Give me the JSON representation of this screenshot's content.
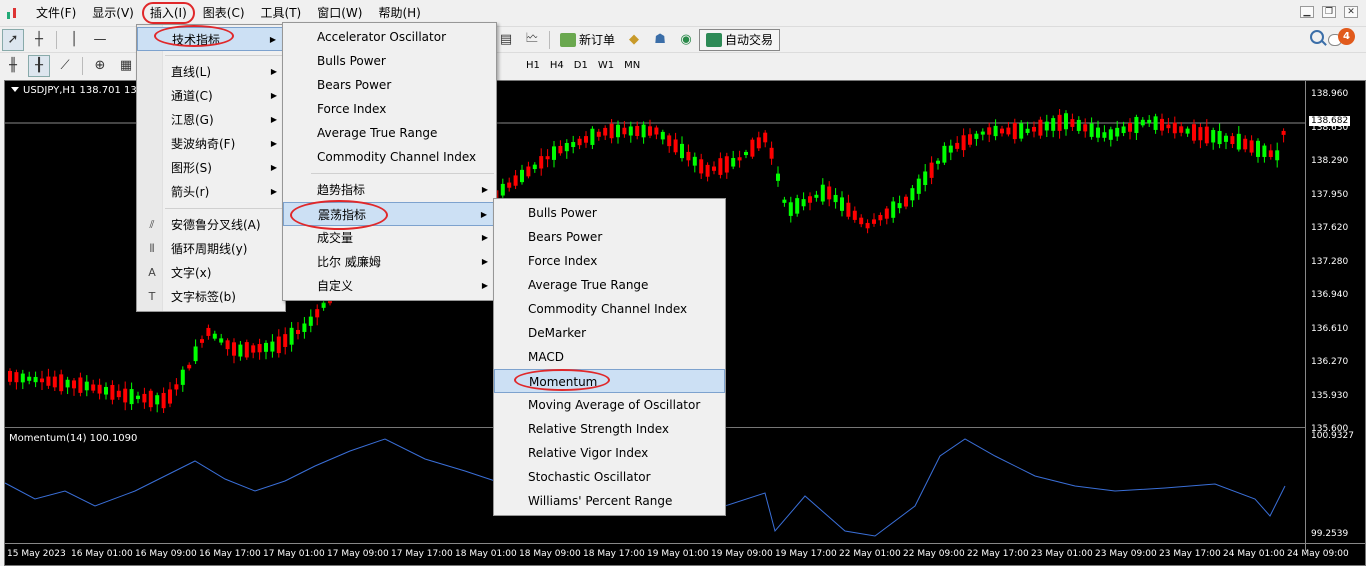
{
  "menubar": {
    "items": [
      "文件(F)",
      "显示(V)",
      "插入(I)",
      "图表(C)",
      "工具(T)",
      "窗口(W)",
      "帮助(H)"
    ],
    "active_index": 2
  },
  "toolbar1": {
    "new_order": "新订单",
    "auto_trading": "自动交易",
    "notification_count": "4"
  },
  "toolbar2": {
    "timeframes": [
      "H1",
      "H4",
      "D1",
      "W1",
      "MN"
    ]
  },
  "chart": {
    "title": "USDJPY,H1  138.701 138.7",
    "current_price": "138.682",
    "price_labels": [
      "138.960",
      "138.630",
      "138.290",
      "137.950",
      "137.620",
      "137.280",
      "136.940",
      "136.610",
      "136.270",
      "135.930",
      "135.600"
    ],
    "indicator_title": "Momentum(14) 100.1090",
    "indicator_labels": [
      "100.9327",
      "99.2539"
    ],
    "time_labels": [
      "15 May 2023",
      "16 May 01:00",
      "16 May 09:00",
      "16 May 17:00",
      "17 May 01:00",
      "17 May 09:00",
      "17 May 17:00",
      "18 May 01:00",
      "18 May 09:00",
      "18 May 17:00",
      "19 May 01:00",
      "19 May 09:00",
      "19 May 17:00",
      "22 May 01:00",
      "22 May 09:00",
      "22 May 17:00",
      "23 May 01:00",
      "23 May 09:00",
      "23 May 17:00",
      "24 May 01:00",
      "24 May 09:00"
    ],
    "colors": {
      "bull": "#00ff00",
      "bear": "#ff0000",
      "momentum": "#3a6fd8"
    }
  },
  "menu_insert": {
    "items": [
      {
        "label": "技术指标",
        "icon": "",
        "submenu": true,
        "highlight": true
      },
      {
        "sep": true
      },
      {
        "label": "直线(L)",
        "icon": "",
        "submenu": true
      },
      {
        "label": "通道(C)",
        "icon": "",
        "submenu": true
      },
      {
        "label": "江恩(G)",
        "icon": "",
        "submenu": true
      },
      {
        "label": "斐波纳奇(F)",
        "icon": "",
        "submenu": true
      },
      {
        "label": "图形(S)",
        "icon": "",
        "submenu": true
      },
      {
        "label": "箭头(r)",
        "icon": "",
        "submenu": true
      },
      {
        "sep": true
      },
      {
        "label": "安德鲁分叉线(A)",
        "icon": "pitchfork-icon",
        "submenu": false
      },
      {
        "label": "循环周期线(y)",
        "icon": "cycle-lines-icon",
        "submenu": false
      },
      {
        "label": "文字(x)",
        "icon": "text-icon",
        "submenu": false
      },
      {
        "label": "文字标签(b)",
        "icon": "text-label-icon",
        "submenu": false
      }
    ]
  },
  "menu_indicators": {
    "items": [
      {
        "label": "Accelerator Oscillator"
      },
      {
        "label": "Bulls Power"
      },
      {
        "label": "Bears Power"
      },
      {
        "label": "Force Index"
      },
      {
        "label": "Average True Range"
      },
      {
        "label": "Commodity Channel Index"
      },
      {
        "sep": true
      },
      {
        "label": "趋势指标",
        "submenu": true
      },
      {
        "label": "震荡指标",
        "submenu": true,
        "highlight": true
      },
      {
        "label": "成交量",
        "submenu": true
      },
      {
        "label": "比尔 威廉姆",
        "submenu": true
      },
      {
        "label": "自定义",
        "submenu": true
      }
    ]
  },
  "menu_oscillators": {
    "items": [
      {
        "label": "Bulls Power"
      },
      {
        "label": "Bears Power"
      },
      {
        "label": "Force Index"
      },
      {
        "label": "Average True Range"
      },
      {
        "label": "Commodity Channel Index"
      },
      {
        "label": "DeMarker"
      },
      {
        "label": "MACD"
      },
      {
        "label": "Momentum",
        "highlight": true
      },
      {
        "label": "Moving Average of Oscillator"
      },
      {
        "label": "Relative Strength Index"
      },
      {
        "label": "Relative Vigor Index"
      },
      {
        "label": "Stochastic Oscillator"
      },
      {
        "label": "Williams' Percent Range"
      }
    ]
  }
}
